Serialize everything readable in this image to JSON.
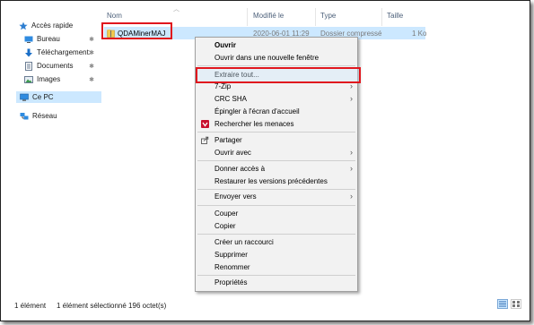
{
  "sidebar": {
    "items": [
      {
        "label": "Accès rapide",
        "icon": "star-icon"
      },
      {
        "label": "Bureau",
        "icon": "desktop-folder-icon",
        "pinned": true
      },
      {
        "label": "Téléchargement:",
        "icon": "download-icon",
        "pinned": true
      },
      {
        "label": "Documents",
        "icon": "documents-icon",
        "pinned": true
      },
      {
        "label": "Images",
        "icon": "images-icon",
        "pinned": true
      },
      {
        "label": "Ce PC",
        "icon": "computer-icon",
        "selected": true
      },
      {
        "label": "Réseau",
        "icon": "network-icon"
      }
    ],
    "pin_glyph": "📌"
  },
  "columns": {
    "name": "Nom",
    "modified": "Modifié le",
    "type": "Type",
    "size": "Taille"
  },
  "file": {
    "name": "QDAMinerMAJ",
    "modified": "2020-06-01 11:29",
    "type": "Dossier compressé",
    "size": "1 Ko"
  },
  "context_menu": {
    "items": [
      {
        "label": "Ouvrir",
        "bold": true
      },
      {
        "label": "Ouvrir dans une nouvelle fenêtre"
      },
      {
        "separator": true
      },
      {
        "label": "Extraire tout...",
        "highlighted": true
      },
      {
        "label": "7-Zip",
        "submenu": true
      },
      {
        "label": "CRC SHA",
        "submenu": true
      },
      {
        "label": "Épingler à l'écran d'accueil"
      },
      {
        "label": "Rechercher les menaces",
        "icon": "antivirus-icon"
      },
      {
        "separator": true
      },
      {
        "label": "Partager",
        "icon": "share-icon"
      },
      {
        "label": "Ouvrir avec",
        "submenu": true
      },
      {
        "separator": true
      },
      {
        "label": "Donner accès à",
        "submenu": true
      },
      {
        "label": "Restaurer les versions précédentes"
      },
      {
        "separator": true
      },
      {
        "label": "Envoyer vers",
        "submenu": true
      },
      {
        "separator": true
      },
      {
        "label": "Couper"
      },
      {
        "label": "Copier"
      },
      {
        "separator": true
      },
      {
        "label": "Créer un raccourci"
      },
      {
        "label": "Supprimer"
      },
      {
        "label": "Renommer"
      },
      {
        "separator": true
      },
      {
        "label": "Propriétés"
      }
    ],
    "submenu_arrow": "›"
  },
  "status_bar": {
    "count": "1 élément",
    "selection": "1 élément sélectionné  196 octet(s)"
  },
  "colors": {
    "accent_selection": "#cce8ff",
    "highlight_box": "#e0161d",
    "menu_background": "#f2f2f2"
  }
}
